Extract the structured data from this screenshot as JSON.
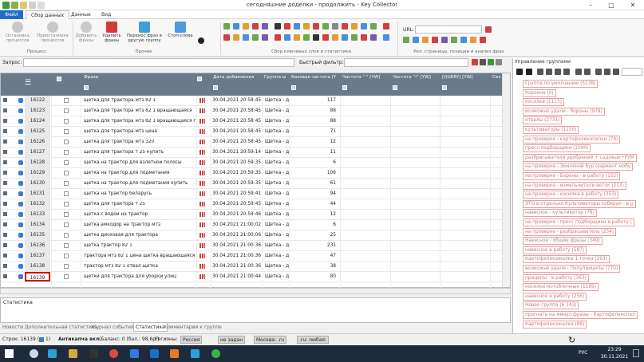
{
  "window": {
    "title": "сегодняшние доделки - продолжить - Key Collector"
  },
  "menu": {
    "file": "Файл",
    "items": [
      "Сбор данных",
      "Данные",
      "Вид"
    ]
  },
  "ribbon": {
    "buttons": [
      {
        "label": "Остановка процессов"
      },
      {
        "label": "Приостановка процессов"
      },
      {
        "label": "Добавить фразы"
      },
      {
        "label": "Удалить фразы"
      },
      {
        "label": "Перенос фраз в другую группу"
      },
      {
        "label": "Стоп-слова"
      }
    ],
    "groups": [
      "Процесс",
      "Прочее",
      "Сбор ключевых слов и статистики",
      "Рел. страницы, позиции и анализ фраз"
    ],
    "url_label": "URL:"
  },
  "query": {
    "label": "Запрос:",
    "filter_label": "Быстрый фильтр:"
  },
  "grid": {
    "headers": [
      "Фраза",
      "Дата добавления",
      "Группа ы",
      "Базовая частота [Y",
      "Частота \" \" [YW]",
      "Частота \"!\" [YW]",
      "[QUERY] [YW]",
      "Сез"
    ],
    "group_value": "Щетка - д",
    "rows": [
      {
        "id": "16122",
        "phrase": "щетка для трактора мтз 82 1",
        "date": "30.04.2021 20:58:45",
        "freq": "117"
      },
      {
        "id": "16123",
        "phrase": "щетка для трактора мтз 82 1 вращающаяся",
        "date": "30.04.2021 20:58:45",
        "freq": "88"
      },
      {
        "id": "16124",
        "phrase": "щетка для трактора мтз 82 1 вращающаяся по",
        "date": "30.04.2021 20:58:45",
        "freq": "88"
      },
      {
        "id": "16125",
        "phrase": "щетка для трактора мтз цена",
        "date": "30.04.2021 20:58:45",
        "freq": "71"
      },
      {
        "id": "16126",
        "phrase": "щетка для трактора мтз 320",
        "date": "30.04.2021 20:58:45",
        "freq": "12"
      },
      {
        "id": "16127",
        "phrase": "щетка для трактора т 25 купить",
        "date": "30.04.2021 20:59:14",
        "freq": "11"
      },
      {
        "id": "16128",
        "phrase": "щетка на трактор для взлетной полосы",
        "date": "30.04.2021 20:59:35",
        "freq": "6"
      },
      {
        "id": "16129",
        "phrase": "щетка на трактор для подметания",
        "date": "30.04.2021 20:59:35",
        "freq": "106"
      },
      {
        "id": "16130",
        "phrase": "щетка на трактор для подметания купить",
        "date": "30.04.2021 20:59:35",
        "freq": "61"
      },
      {
        "id": "16131",
        "phrase": "щетка на трактор беларусь",
        "date": "30.04.2021 20:59:41",
        "freq": "94"
      },
      {
        "id": "16132",
        "phrase": "щетка для трактора т 25",
        "date": "30.04.2021 20:59:45",
        "freq": "44"
      },
      {
        "id": "16133",
        "phrase": "щетка с водой на трактор",
        "date": "30.04.2021 20:59:46",
        "freq": "12"
      },
      {
        "id": "16134",
        "phrase": "щетка амкодор на трактор мтз",
        "date": "30.04.2021 21:00:02",
        "freq": "6"
      },
      {
        "id": "16135",
        "phrase": "щетка дисковая для трактора",
        "date": "30.04.2021 21:00:06",
        "freq": "25"
      },
      {
        "id": "16136",
        "phrase": "щетка трактор 82 1",
        "date": "30.04.2021 21:00:36",
        "freq": "231"
      },
      {
        "id": "16137",
        "phrase": "трактора мтз 82 1 цена щетка вращающаяся",
        "date": "30.04.2021 21:00:36",
        "freq": "47"
      },
      {
        "id": "16138",
        "phrase": "трактор мтз 82 1 отвал щетка",
        "date": "30.04.2021 21:00:36",
        "freq": "38"
      },
      {
        "id": "16139",
        "phrase": "щетки для трактора для уборки улиц",
        "date": "30.04.2021 21:00:44",
        "freq": "80"
      }
    ]
  },
  "stats": {
    "label": "Статистика"
  },
  "tabs": [
    "Новости",
    "Дополнительная статистика",
    "Журнал событий",
    "Статистика",
    "Комментарии к группе"
  ],
  "status": {
    "rows": "Строк: 16139 (",
    "rows_tail": "1)",
    "antikapcha": "Антикапча вкл.",
    "balance": "(Баланс: 0 (бал.: 98,6р.)",
    "regions": "Регионы:",
    "r1": "Россия",
    "r2": "не задан",
    "r3": "Москва: .ru",
    "r4": ".ru: любая:"
  },
  "groups_panel": {
    "title": "Управление группами",
    "items": [
      "Группа по умолчанию (5238)",
      "Корзина (0)",
      "косилка (1113)",
      "возможно удали - бороны (979)",
      "отвалы (2731)",
      "культиваторы (1150)",
      "на проверке - картофелекопалки (79)",
      "пресс-подборщики (1090)",
      "разбрасыватели удобрений + садовые+РУМ",
      "на проверке - Земляной бур (вариант мобу",
      "на проверке - Бороны - в работу (152)",
      "на проверке - измельчители веток (213)",
      "на проверке - косилка в работу (353)",
      "ЭТО в отдельно Культиваторы собирал - в р",
      "навесное - культиватор (78)",
      "на проверке - пресс подборщики в работу (",
      "на проверке - разбрасыватель (234)",
      "Навесное - общие фразы (349)",
      "навесное в работу (587)",
      "Картофелекажалка 1 точка (163)",
      "возможно удали - Полуприцепы (770)",
      "прицепы - в работу (363)",
      "косилки мотоблочные (1199)",
      "навесное в работу (256)",
      "Новая группа (6 143)",
      "прогнать на минус-фразы - Картофелекопал",
      "Картофелекажалка (86)"
    ]
  },
  "taskbar": {
    "lang": "РУС",
    "time": "23:29",
    "date": "30.11.2021"
  },
  "colors": {
    "header": "#6b7a8a",
    "accent": "#1f6fc5",
    "taskbar": "#1e2b3c",
    "highlight": "#cc0000"
  }
}
